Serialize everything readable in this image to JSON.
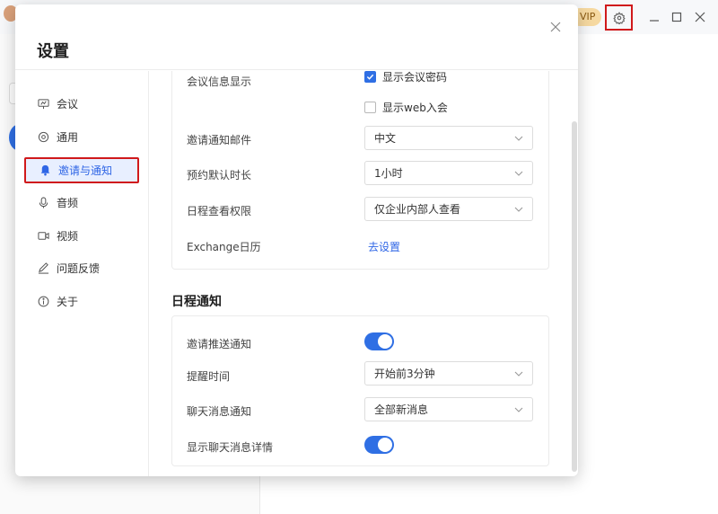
{
  "topbar": {
    "vip_label": "VIP"
  },
  "dialog": {
    "title": "设置"
  },
  "sidebar": {
    "items": [
      {
        "label": "会议",
        "icon": "meeting-icon"
      },
      {
        "label": "通用",
        "icon": "settings-icon"
      },
      {
        "label": "邀请与通知",
        "icon": "bell-icon"
      },
      {
        "label": "音频",
        "icon": "microphone-icon"
      },
      {
        "label": "视频",
        "icon": "camera-icon"
      },
      {
        "label": "问题反馈",
        "icon": "pencil-icon"
      },
      {
        "label": "关于",
        "icon": "info-icon"
      }
    ]
  },
  "invite": {
    "meeting_info_label": "会议信息显示",
    "show_password_label": "显示会议密码",
    "show_password_checked": true,
    "show_web_label": "显示web入会",
    "show_web_checked": false,
    "email_label": "邀请通知邮件",
    "email_value": "中文",
    "duration_label": "预约默认时长",
    "duration_value": "1小时",
    "permission_label": "日程查看权限",
    "permission_value": "仅企业内部人查看",
    "exchange_label": "Exchange日历",
    "exchange_link": "去设置"
  },
  "schedule": {
    "section_title": "日程通知",
    "push_label": "邀请推送通知",
    "push_on": true,
    "reminder_label": "提醒时间",
    "reminder_value": "开始前3分钟",
    "chat_label": "聊天消息通知",
    "chat_value": "全部新消息",
    "detail_label": "显示聊天消息详情",
    "detail_on": true
  },
  "colors": {
    "accent": "#2f6fe4",
    "highlight_border": "#d0191b"
  }
}
